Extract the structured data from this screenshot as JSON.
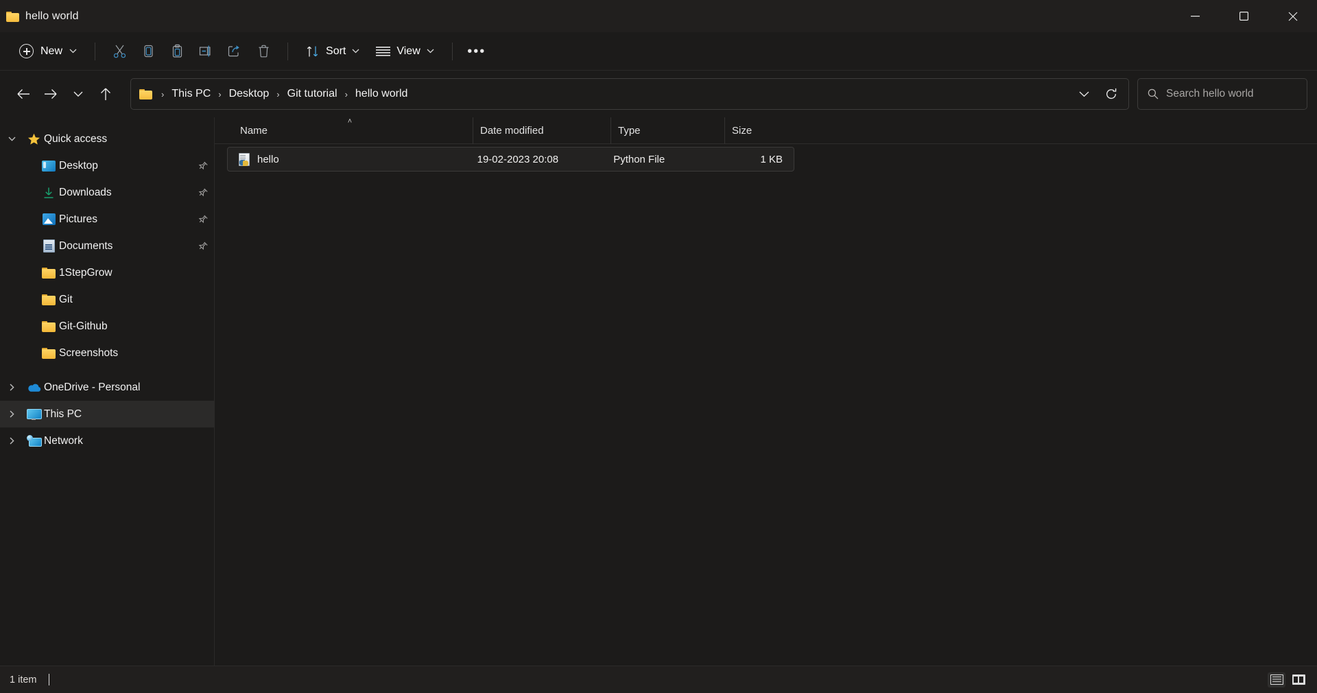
{
  "window": {
    "title": "hello world",
    "folder_icon": "folder-icon",
    "minimize_label": "Minimize",
    "maximize_label": "Maximize",
    "close_label": "Close"
  },
  "toolbar": {
    "new_label": "New",
    "new_icon": "plus-circle-icon",
    "cut_icon": "scissors-icon",
    "copy_icon": "copy-icon",
    "paste_icon": "clipboard-icon",
    "rename_icon": "rename-icon",
    "share_icon": "share-icon",
    "delete_icon": "trash-icon",
    "sort_label": "Sort",
    "sort_icon": "sort-arrows-icon",
    "view_label": "View",
    "view_icon": "view-lines-icon",
    "more_label": "•••",
    "chevron_icon": "chevron-down-icon"
  },
  "address": {
    "back_icon": "arrow-left-icon",
    "forward_icon": "arrow-right-icon",
    "recent_icon": "chevron-down-icon",
    "up_icon": "arrow-up-icon",
    "folder_icon": "folder-icon",
    "breadcrumbs": [
      {
        "label": "This PC"
      },
      {
        "label": "Desktop"
      },
      {
        "label": "Git tutorial"
      },
      {
        "label": "hello world"
      }
    ],
    "separator": "›",
    "dropdown_icon": "chevron-down-icon",
    "refresh_icon": "refresh-icon"
  },
  "search": {
    "placeholder": "Search hello world",
    "value": "",
    "icon": "search-icon"
  },
  "sidebar": {
    "groups": [
      {
        "label": "Quick access",
        "icon": "star-icon",
        "twisty": "⌄",
        "expanded": true,
        "items": [
          {
            "label": "Desktop",
            "icon": "desktop-icon",
            "pinned": true
          },
          {
            "label": "Downloads",
            "icon": "download-icon",
            "pinned": true
          },
          {
            "label": "Pictures",
            "icon": "pictures-icon",
            "pinned": true
          },
          {
            "label": "Documents",
            "icon": "documents-icon",
            "pinned": true
          },
          {
            "label": "1StepGrow",
            "icon": "folder-icon",
            "pinned": false
          },
          {
            "label": "Git",
            "icon": "folder-icon",
            "pinned": false
          },
          {
            "label": "Git-Github",
            "icon": "folder-icon",
            "pinned": false
          },
          {
            "label": "Screenshots",
            "icon": "folder-icon",
            "pinned": false
          }
        ]
      }
    ],
    "roots": [
      {
        "label": "OneDrive - Personal",
        "icon": "onedrive-cloud-icon",
        "twisty": "›",
        "selected": false
      },
      {
        "label": "This PC",
        "icon": "this-pc-icon",
        "twisty": "›",
        "selected": true
      },
      {
        "label": "Network",
        "icon": "network-icon",
        "twisty": "›",
        "selected": false
      }
    ]
  },
  "filelist": {
    "columns": [
      {
        "key": "name",
        "label": "Name",
        "sorted": "asc"
      },
      {
        "key": "date",
        "label": "Date modified",
        "sorted": ""
      },
      {
        "key": "type",
        "label": "Type",
        "sorted": ""
      },
      {
        "key": "size",
        "label": "Size",
        "sorted": ""
      }
    ],
    "sort_caret": "˄",
    "rows": [
      {
        "name": "hello",
        "date": "19-02-2023 20:08",
        "type": "Python File",
        "size": "1 KB",
        "icon": "python-file-icon",
        "selected": true
      }
    ]
  },
  "statusbar": {
    "item_count": "1 item",
    "details_view_icon": "details-view-icon",
    "large_icons_view_icon": "large-icons-view-icon"
  },
  "colors": {
    "window_bg": "#202020",
    "chrome_bg": "#1c1b1a",
    "titlebar_bg": "#211f1e",
    "accent_folder": "#ffd464",
    "selection_bg": "#2b2a29",
    "close_hover": "#c42b1c",
    "text_primary": "#f1f1f1",
    "text_muted": "#a8a6a4"
  }
}
